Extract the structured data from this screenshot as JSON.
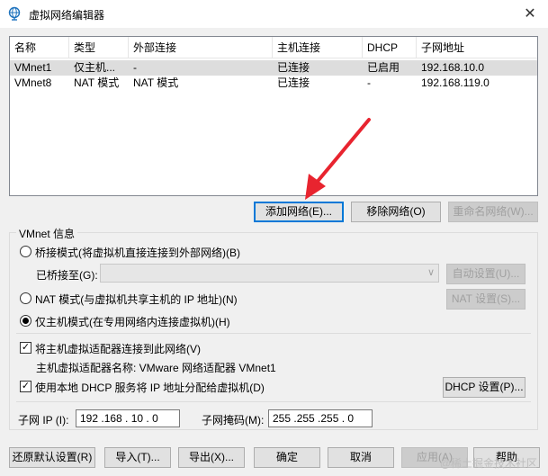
{
  "window": {
    "title": "虚拟网络编辑器",
    "close": "✕"
  },
  "table": {
    "headers": [
      "名称",
      "类型",
      "外部连接",
      "主机连接",
      "DHCP",
      "子网地址"
    ],
    "rows": [
      [
        "VMnet1",
        "仅主机...",
        "-",
        "已连接",
        "已启用",
        "192.168.10.0"
      ],
      [
        "VMnet8",
        "NAT 模式",
        "NAT 模式",
        "已连接",
        "-",
        "192.168.119.0"
      ]
    ]
  },
  "list_buttons": {
    "add": "添加网络(E)...",
    "remove": "移除网络(O)",
    "rename": "重命名网络(W)..."
  },
  "vmnet_info": {
    "title": "VMnet 信息",
    "bridge_mode": "桥接模式(将虚拟机直接连接到外部网络)(B)",
    "bridged_to_label": "已桥接至(G):",
    "bridged_to_value": "",
    "auto_settings": "自动设置(U)...",
    "nat_mode": "NAT 模式(与虚拟机共享主机的 IP 地址)(N)",
    "nat_settings": "NAT 设置(S)...",
    "host_only_mode": "仅主机模式(在专用网络内连接虚拟机)(H)",
    "connect_adapter": "将主机虚拟适配器连接到此网络(V)",
    "adapter_name": "主机虚拟适配器名称: VMware 网络适配器 VMnet1",
    "use_dhcp": "使用本地 DHCP 服务将 IP 地址分配给虚拟机(D)",
    "dhcp_settings": "DHCP 设置(P)...",
    "subnet_ip_label": "子网 IP (I):",
    "subnet_ip": "192 .168 . 10 . 0",
    "subnet_mask_label": "子网掩码(M):",
    "subnet_mask": "255 .255 .255 . 0"
  },
  "footer_buttons": {
    "restore": "还原默认设置(R)",
    "import": "导入(T)...",
    "export": "导出(X)...",
    "ok": "确定",
    "cancel": "取消",
    "apply": "应用(A)",
    "help": "帮助"
  },
  "watermark": "@稀土掘金技术社区",
  "colors": {
    "annotation_arrow": "#e8242f",
    "focus": "#0078d7"
  }
}
